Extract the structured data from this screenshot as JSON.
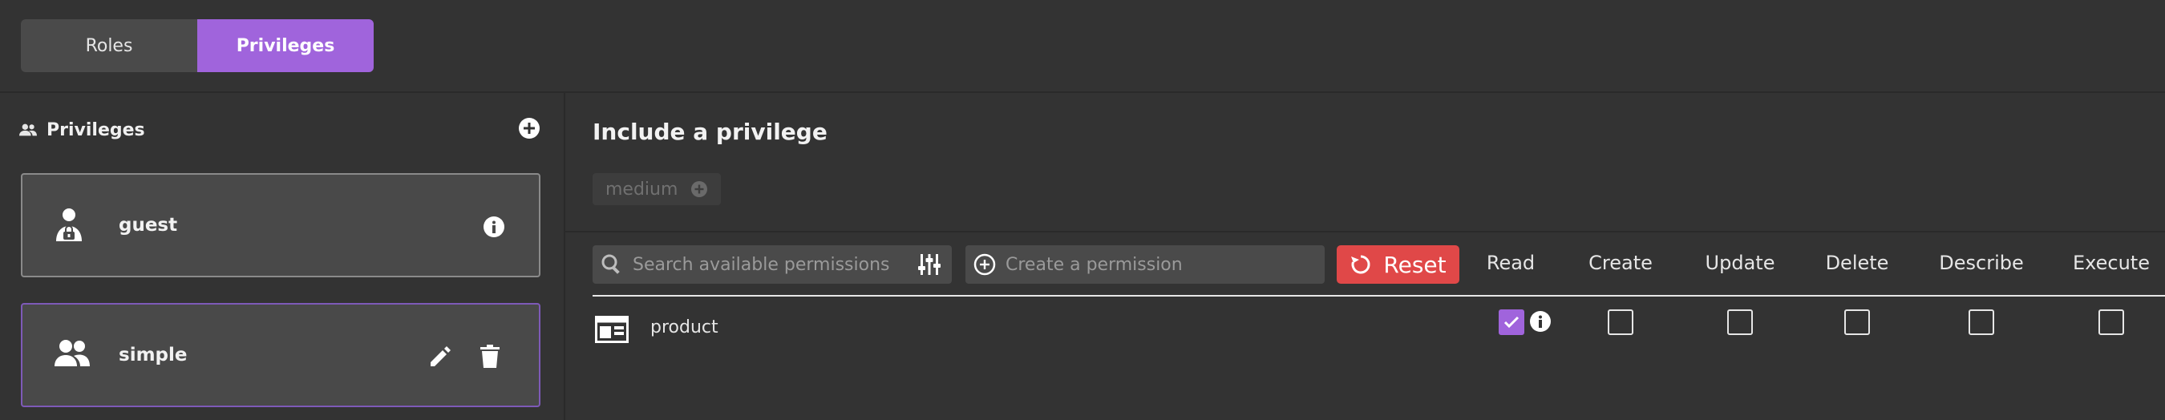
{
  "tabs": {
    "roles": "Roles",
    "privileges": "Privileges"
  },
  "sidebar": {
    "title": "Privileges",
    "items": [
      {
        "name": "guest"
      },
      {
        "name": "simple"
      }
    ]
  },
  "main": {
    "title": "Include a privilege",
    "chip": "medium",
    "search_placeholder": "Search available permissions",
    "create_placeholder": "Create a permission",
    "reset_label": "Reset",
    "columns": [
      "Read",
      "Create",
      "Update",
      "Delete",
      "Describe",
      "Execute"
    ],
    "rows": [
      {
        "label": "product",
        "read": true,
        "create": false,
        "update": false,
        "delete": false,
        "describe": false,
        "execute": false
      }
    ]
  },
  "colors": {
    "accent": "#a064dc",
    "reset": "#e04848",
    "bg": "#333333",
    "card": "#494949"
  }
}
